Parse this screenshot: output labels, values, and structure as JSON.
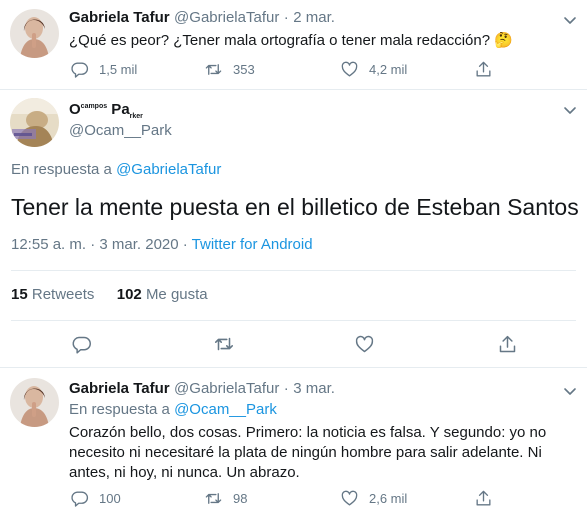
{
  "tweet1": {
    "name": "Gabriela Tafur",
    "handle": "@GabrielaTafur",
    "sep": "·",
    "date": "2 mar.",
    "text": "¿Qué es peor? ¿Tener mala ortografía o tener mala redacción?",
    "emoji": "🤔",
    "replies": "1,5 mil",
    "retweets": "353",
    "likes": "4,2 mil"
  },
  "tweet2": {
    "name_parts": [
      "O",
      "campos",
      " Pa",
      "rker"
    ],
    "handle": "@Ocam__Park",
    "reply_prefix": "En respuesta a",
    "reply_to": "@GabrielaTafur",
    "text": "Tener la mente puesta en el billetico de Esteban Santos",
    "time": "12:55 a. m. · 3 mar. 2020",
    "sep": "·",
    "source": "Twitter for Android",
    "retweets_count": "15",
    "retweets_label": "Retweets",
    "likes_count": "102",
    "likes_label": "Me gusta"
  },
  "tweet3": {
    "name": "Gabriela Tafur",
    "handle": "@GabrielaTafur",
    "sep": "·",
    "date": "3 mar.",
    "reply_prefix": "En respuesta a",
    "reply_to": "@Ocam__Park",
    "text": "Corazón bello, dos cosas. Primero: la noticia es falsa. Y segundo: yo no necesito ni necesitaré la plata de ningún hombre para salir adelante. Ni antes, ni hoy, ni nunca. Un abrazo.",
    "replies": "100",
    "retweets": "98",
    "likes": "2,6 mil"
  },
  "icons": {
    "reply": "reply-icon",
    "retweet": "retweet-icon",
    "like": "heart-icon",
    "share": "share-icon",
    "more": "chevron-down-icon"
  },
  "colors": {
    "text": "#14171a",
    "muted": "#657786",
    "link": "#1b95e0",
    "divider": "#e6ecf0"
  }
}
